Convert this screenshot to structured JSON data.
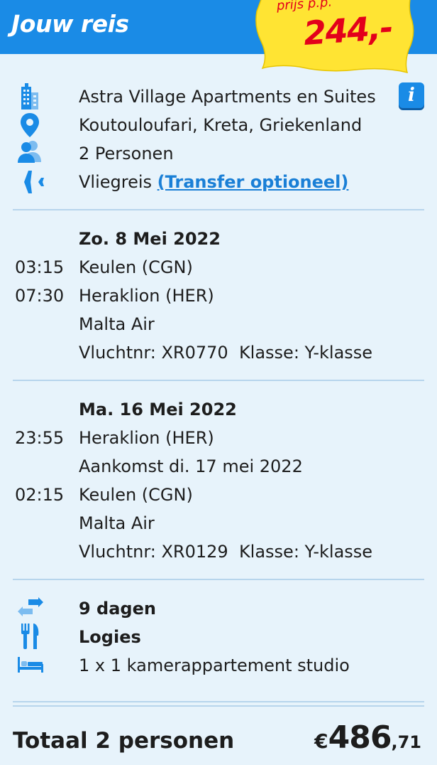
{
  "header": {
    "title": "Jouw reis",
    "price_label": "prijs p.p.",
    "price_value": "244,-"
  },
  "colors": {
    "header_blue": "#1a8be6",
    "background": "#e7f3fb",
    "badge_yellow": "#ffe433",
    "price_red": "#e3001b",
    "link_blue": "#1a7fd6",
    "icon_blue": "#1a8be6"
  },
  "summary": {
    "hotel": "Astra Village Apartments en Suites",
    "location": "Koutouloufari, Kreta, Griekenland",
    "persons": "2 Personen",
    "travel_type": "Vliegreis",
    "transfer_link": "(Transfer optioneel)",
    "icons": [
      "building-icon",
      "location-pin-icon",
      "persons-icon",
      "airplane-icon",
      "info-icon"
    ]
  },
  "outbound": {
    "date": "Zo. 8 Mei 2022",
    "dep_time": "03:15",
    "dep_place": "Keulen (CGN)",
    "arr_time": "07:30",
    "arr_place": "Heraklion (HER)",
    "airline": "Malta Air",
    "flight": "Vluchtnr: XR0770  Klasse: Y-klasse"
  },
  "return": {
    "date": "Ma. 16 Mei 2022",
    "dep_time": "23:55",
    "dep_place": "Heraklion (HER)",
    "arrival_note": "Aankomst di. 17 mei 2022",
    "arr_time": "02:15",
    "arr_place": "Keulen (CGN)",
    "airline": "Malta Air",
    "flight": "Vluchtnr: XR0129  Klasse: Y-klasse"
  },
  "stay": {
    "duration": "9 dagen",
    "board": "Logies",
    "room": "1 x 1 kamerappartement studio",
    "icons": [
      "arrows-exchange-icon",
      "cutlery-icon",
      "bed-icon"
    ]
  },
  "total": {
    "label": "Totaal 2 personen",
    "currency": "€",
    "amount_int": "486",
    "amount_dec": ",71"
  }
}
